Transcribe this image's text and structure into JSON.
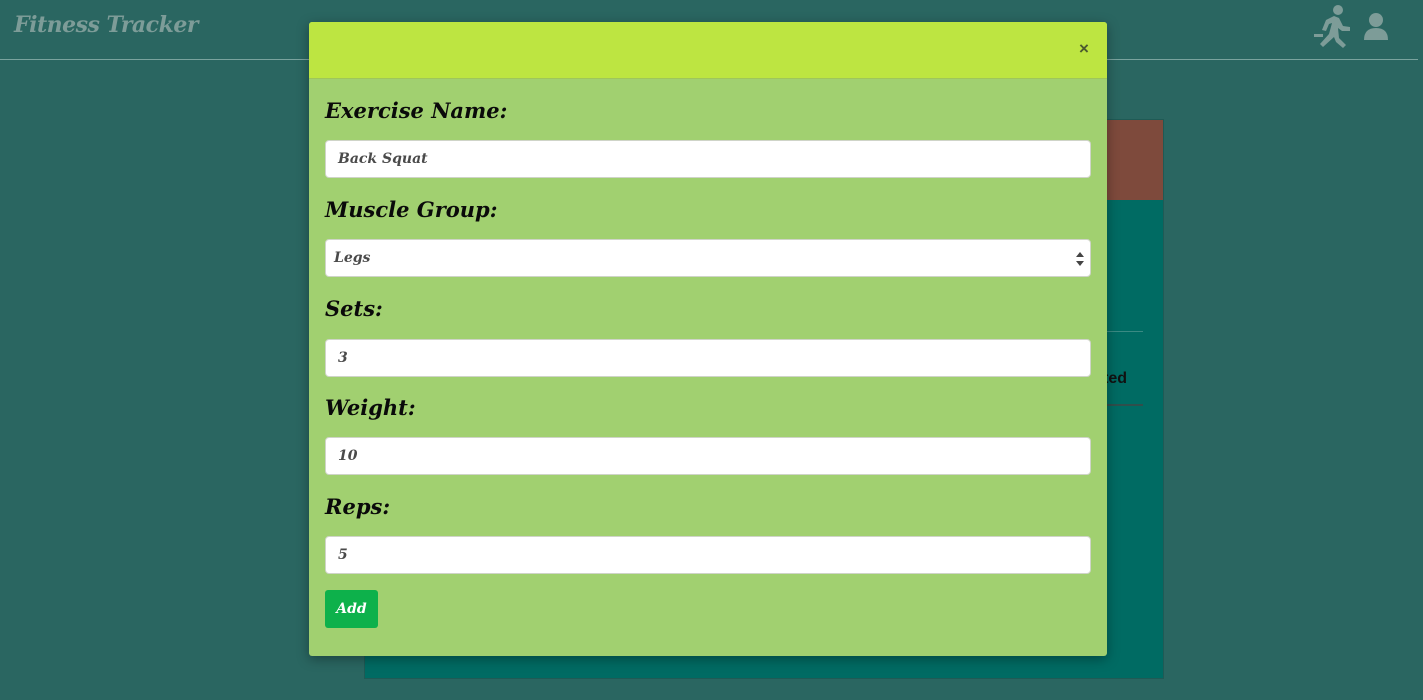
{
  "navbar": {
    "brand": "Fitness Tracker",
    "icons": [
      "running-person-icon",
      "user-icon"
    ]
  },
  "background": {
    "partial_text": "ted"
  },
  "modal": {
    "close_label": "×",
    "fields": {
      "exercise_name": {
        "label": "Exercise Name:",
        "value": "Back Squat"
      },
      "muscle_group": {
        "label": "Muscle Group:",
        "value": "Legs"
      },
      "sets": {
        "label": "Sets:",
        "value": "3"
      },
      "weight": {
        "label": "Weight:",
        "value": "10"
      },
      "reps": {
        "label": "Reps:",
        "value": "5"
      }
    },
    "submit_label": "Add"
  },
  "colors": {
    "page_bg": "#2a6661",
    "modal_header": "#bde541",
    "modal_body": "#a1d070",
    "add_button": "#0db14b",
    "card_header": "#7e4a3c",
    "card_body": "#006b63"
  }
}
